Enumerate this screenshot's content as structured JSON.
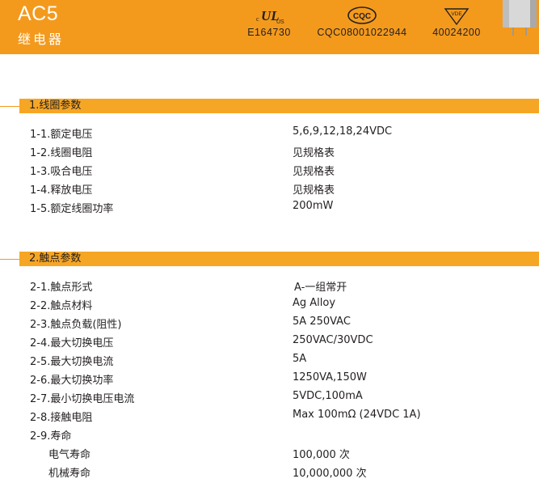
{
  "header": {
    "model": "AC5",
    "subtitle": "继电器",
    "certs": [
      {
        "logo": "UL",
        "number": "E164730"
      },
      {
        "logo": "CQC",
        "number": "CQC08001022944"
      },
      {
        "logo": "VDE",
        "number": "40024200"
      }
    ],
    "colors": {
      "accent": "#f39a1d",
      "bar": "#f6a625"
    }
  },
  "sections": [
    {
      "title": "1.线圈参数",
      "rows": [
        {
          "label": "1-1.额定电压",
          "value": "5,6,9,12,18,24VDC"
        },
        {
          "label": "1-2.线圈电阻",
          "value": "见规格表"
        },
        {
          "label": "1-3.吸合电压",
          "value": "见规格表"
        },
        {
          "label": "1-4.释放电压",
          "value": "见规格表"
        },
        {
          "label": "1-5.额定线圈功率",
          "value": "200mW"
        }
      ]
    },
    {
      "title": "2.触点参数",
      "rows": [
        {
          "label": "2-1.触点形式",
          "value": "A-一组常开"
        },
        {
          "label": "2-2.触点材料",
          "value": "Ag Alloy"
        },
        {
          "label": "2-3.触点负载(阻性)",
          "value": "5A 250VAC"
        },
        {
          "label": "2-4.最大切换电压",
          "value": "250VAC/30VDC"
        },
        {
          "label": "2-5.最大切换电流",
          "value": "5A"
        },
        {
          "label": "2-6.最大切换功率",
          "value": "1250VA,150W"
        },
        {
          "label": "2-7.最小切换电压电流",
          "value": "5VDC,100mA"
        },
        {
          "label": "2-8.接触电阻",
          "value": "Max 100mΩ (24VDC 1A)"
        },
        {
          "label": "2-9.寿命",
          "value": ""
        },
        {
          "label": "电气寿命",
          "value": "100,000  次"
        },
        {
          "label": "机械寿命",
          "value": "10,000,000 次"
        }
      ]
    }
  ]
}
